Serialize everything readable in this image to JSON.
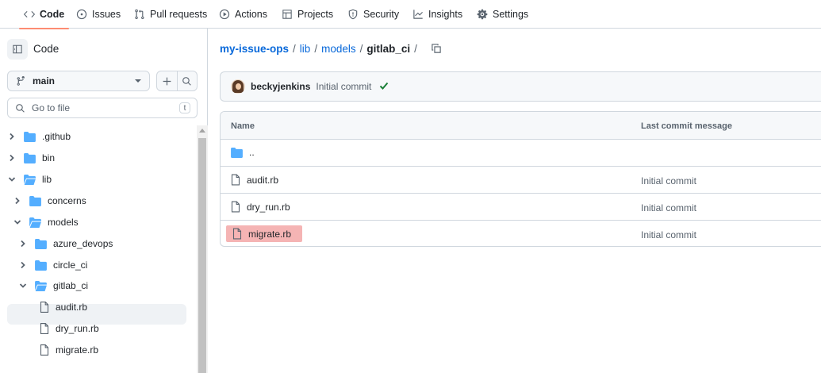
{
  "nav": {
    "tabs": [
      {
        "label": "Code",
        "icon": "code-icon",
        "active": true
      },
      {
        "label": "Issues",
        "icon": "issue-icon"
      },
      {
        "label": "Pull requests",
        "icon": "pull-request-icon"
      },
      {
        "label": "Actions",
        "icon": "play-icon"
      },
      {
        "label": "Projects",
        "icon": "table-icon"
      },
      {
        "label": "Security",
        "icon": "shield-icon"
      },
      {
        "label": "Insights",
        "icon": "graph-icon"
      },
      {
        "label": "Settings",
        "icon": "gear-icon"
      }
    ],
    "active_color": "#fd8c73"
  },
  "sidebar": {
    "title": "Code",
    "branch": "main",
    "goto_placeholder": "Go to file",
    "goto_shortcut": "t",
    "tree": [
      {
        "label": ".github",
        "type": "folder",
        "expanded": false
      },
      {
        "label": "bin",
        "type": "folder",
        "expanded": false
      },
      {
        "label": "lib",
        "type": "folder",
        "expanded": true
      },
      {
        "label": "concerns",
        "type": "folder",
        "expanded": false
      },
      {
        "label": "models",
        "type": "folder",
        "expanded": true
      },
      {
        "label": "azure_devops",
        "type": "folder",
        "expanded": false
      },
      {
        "label": "circle_ci",
        "type": "folder",
        "expanded": false
      },
      {
        "label": "gitlab_ci",
        "type": "folder",
        "expanded": true,
        "selected": true
      },
      {
        "label": "audit.rb",
        "type": "file"
      },
      {
        "label": "dry_run.rb",
        "type": "file"
      },
      {
        "label": "migrate.rb",
        "type": "file"
      }
    ]
  },
  "breadcrumb": {
    "repo": "my-issue-ops",
    "parts": [
      "lib",
      "models"
    ],
    "current": "gitlab_ci",
    "sep": "/"
  },
  "commit": {
    "author": "beckyjenkins",
    "message": "Initial commit",
    "status_color": "#1a7f37"
  },
  "files": {
    "headers": {
      "name": "Name",
      "message": "Last commit message"
    },
    "parent": "..",
    "rows": [
      {
        "name": "audit.rb",
        "message": "Initial commit"
      },
      {
        "name": "dry_run.rb",
        "message": "Initial commit"
      },
      {
        "name": "migrate.rb",
        "message": "Initial commit",
        "highlighted": true
      }
    ],
    "highlight_color": "#f5b4b4"
  },
  "colors": {
    "link": "#0969da",
    "folder": "#54aeff",
    "border": "#d0d7de"
  }
}
